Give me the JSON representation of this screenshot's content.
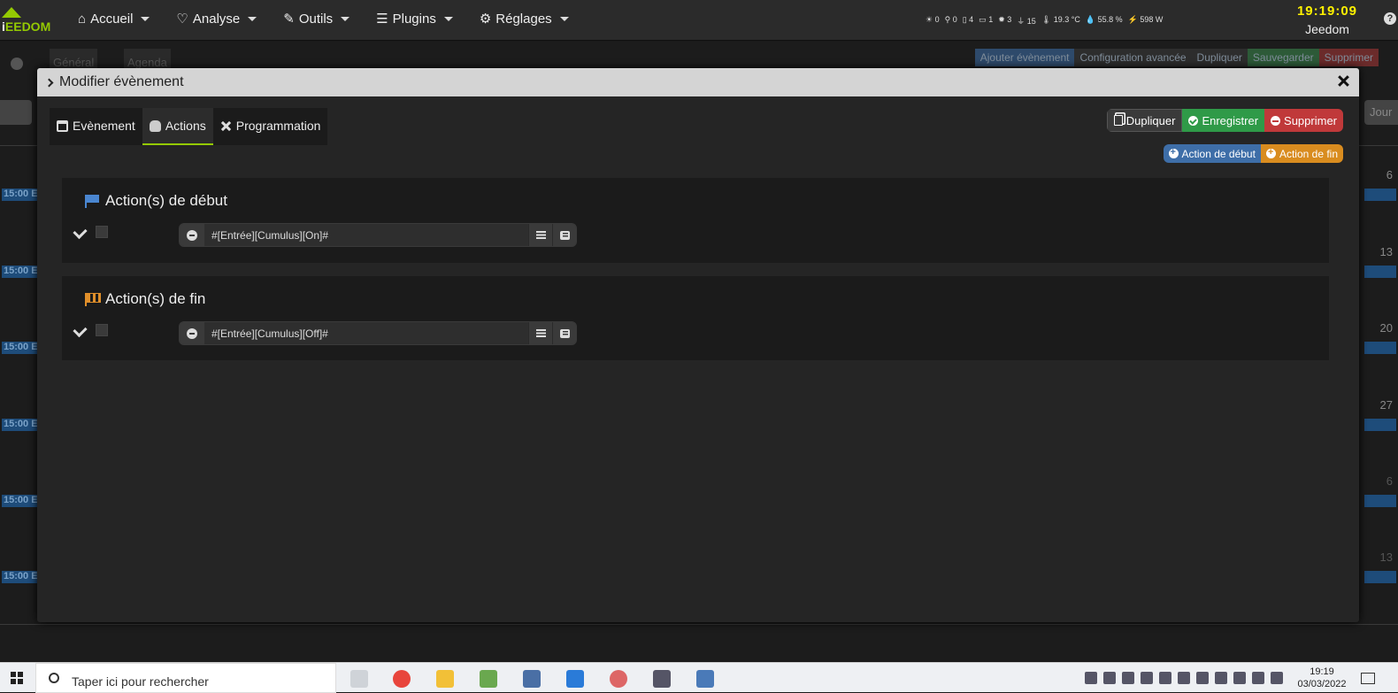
{
  "topnav": {
    "logo_text": "EEDOM",
    "items": [
      {
        "label": "Accueil",
        "icon": "home-icon"
      },
      {
        "label": "Analyse",
        "icon": "stethoscope-icon"
      },
      {
        "label": "Outils",
        "icon": "wrench-icon"
      },
      {
        "label": "Plugins",
        "icon": "tasks-icon"
      },
      {
        "label": "Réglages",
        "icon": "cog-icon"
      }
    ],
    "sensors": [
      "0",
      "0",
      "4",
      "1",
      "3",
      "15",
      "19.3 °C",
      "55.8 %",
      "598 W"
    ],
    "time": "19:19:09",
    "user": "Jeedom",
    "help": "?"
  },
  "background": {
    "tabs": [
      "Général",
      "Agenda"
    ],
    "buttons": [
      "Ajouter évènement",
      "Configuration avancée",
      "Dupliquer",
      "Sauvegarder",
      "Supprimer"
    ],
    "jour_label": "Jour",
    "event_label": "15:00 E",
    "day_numbers": [
      "6",
      "13",
      "20",
      "27",
      "6",
      "13"
    ]
  },
  "modal": {
    "title": "Modifier évènement",
    "tabs": [
      {
        "label": "Evènement",
        "active": false
      },
      {
        "label": "Actions",
        "active": true
      },
      {
        "label": "Programmation",
        "active": false
      }
    ],
    "buttons": {
      "duplicate": "Dupliquer",
      "save": "Enregistrer",
      "delete": "Supprimer"
    },
    "add_buttons": {
      "start": "Action de début",
      "end": "Action de fin"
    },
    "sections": [
      {
        "title": "Action(s) de début",
        "command": "#[Entrée][Cumulus][On]#"
      },
      {
        "title": "Action(s) de fin",
        "command": "#[Entrée][Cumulus][Off]#"
      }
    ]
  },
  "taskbar": {
    "search_placeholder": "Taper ici pour rechercher",
    "time": "19:19",
    "date": "03/03/2022"
  },
  "colors": {
    "accent": "#94ca02",
    "green": "#2f9a48",
    "red": "#c0393a",
    "blue": "#3e6ea8",
    "orange": "#d98c1f"
  }
}
